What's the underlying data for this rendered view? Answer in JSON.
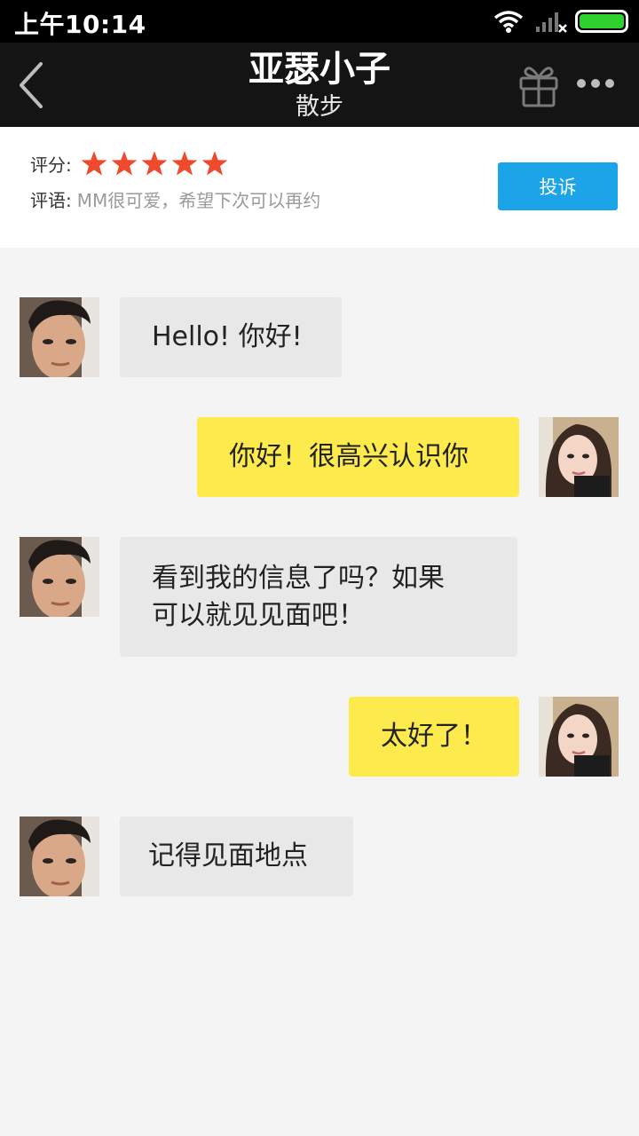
{
  "status_bar": {
    "time": "上午10:14",
    "icons": [
      "wifi-icon",
      "signal-icon",
      "battery-icon"
    ],
    "battery_color": "#2ed12e"
  },
  "header": {
    "title": "亚瑟小子",
    "subtitle": "散步",
    "icons": [
      "back-chevron-icon",
      "gift-icon",
      "more-dots-icon"
    ]
  },
  "rating": {
    "score_label": "评分:",
    "stars": 5,
    "star_color": "#f04a2c",
    "comment_label": "评语:",
    "comment_text": "MM很可爱，希望下次可以再约",
    "complain_button": "投诉",
    "complain_color": "#1ba4e8"
  },
  "messages": [
    {
      "side": "incoming",
      "avatar": "male-avatar",
      "text": "Hello! 你好!"
    },
    {
      "side": "outgoing",
      "avatar": "female-avatar",
      "text": "你好！很高兴认识你"
    },
    {
      "side": "incoming",
      "avatar": "male-avatar",
      "lines": [
        "看到我的信息了吗？如果",
        "可以就见见面吧！"
      ]
    },
    {
      "side": "outgoing",
      "avatar": "female-avatar",
      "text": "太好了！"
    },
    {
      "side": "incoming",
      "avatar": "male-avatar",
      "text": "记得见面地点"
    }
  ],
  "colors": {
    "incoming_bubble": "#e8e8e8",
    "outgoing_bubble": "#fdea4d",
    "chat_background": "#f4f4f4"
  }
}
